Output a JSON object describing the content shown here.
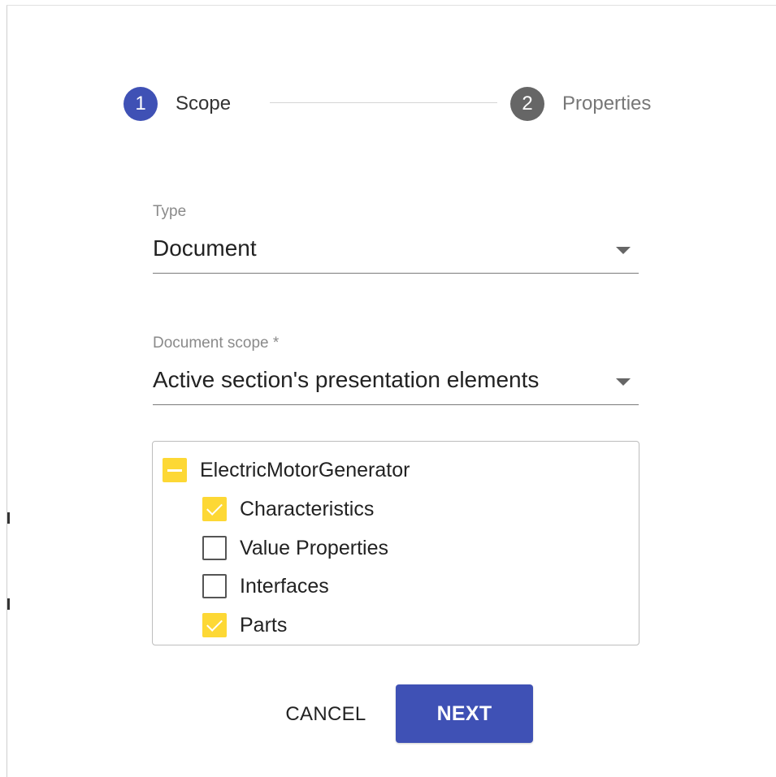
{
  "colors": {
    "primary": "#3f51b5",
    "inactive_step": "#666666",
    "checkbox_checked": "#fdd835",
    "label_active": "#333333",
    "label_inactive": "#777777"
  },
  "stepper": {
    "steps": [
      {
        "number": "1",
        "label": "Scope",
        "state": "active"
      },
      {
        "number": "2",
        "label": "Properties",
        "state": "inactive"
      }
    ]
  },
  "form": {
    "type": {
      "label": "Type",
      "value": "Document"
    },
    "scope": {
      "label": "Document scope *",
      "value": "Active section's presentation elements"
    }
  },
  "tree": {
    "root": {
      "label": "ElectricMotorGenerator",
      "state": "indeterminate"
    },
    "children": [
      {
        "label": "Characteristics",
        "checked": true
      },
      {
        "label": "Value Properties",
        "checked": false
      },
      {
        "label": "Interfaces",
        "checked": false
      },
      {
        "label": "Parts",
        "checked": true
      }
    ]
  },
  "actions": {
    "cancel_label": "CANCEL",
    "next_label": "NEXT"
  }
}
